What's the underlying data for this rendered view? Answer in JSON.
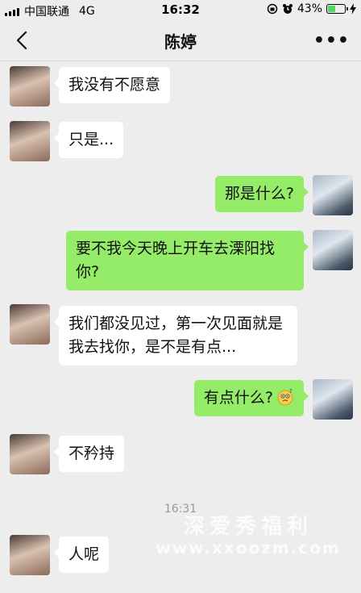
{
  "status_bar": {
    "carrier": "中国联通",
    "network": "4G",
    "time": "16:32",
    "battery": "43%",
    "battery_level": 0.43
  },
  "nav": {
    "title": "陈婷",
    "back_icon": "chevron-left-icon",
    "more_label": "•••"
  },
  "messages": [
    {
      "sender": "contact",
      "text": "我没有不愿意"
    },
    {
      "sender": "contact",
      "text": "只是..."
    },
    {
      "sender": "me",
      "text": "那是什么?"
    },
    {
      "sender": "me",
      "text": "要不我今天晚上开车去溧阳找你?"
    },
    {
      "sender": "contact",
      "text": "我们都没见过，第一次见面就是我去找你，是不是有点..."
    },
    {
      "sender": "me",
      "text": "有点什么?",
      "emoji": "confused-face-icon"
    },
    {
      "sender": "contact",
      "text": "不矜持"
    },
    {
      "sender": "contact",
      "text": "人呢"
    }
  ],
  "timestamp": "16:31",
  "watermark": {
    "line1": "深爱秀福利",
    "line2": "www.xxoozm.com"
  },
  "colors": {
    "incoming_bubble": "#ffffff",
    "outgoing_bubble": "#95ec69",
    "background": "#ededed"
  }
}
